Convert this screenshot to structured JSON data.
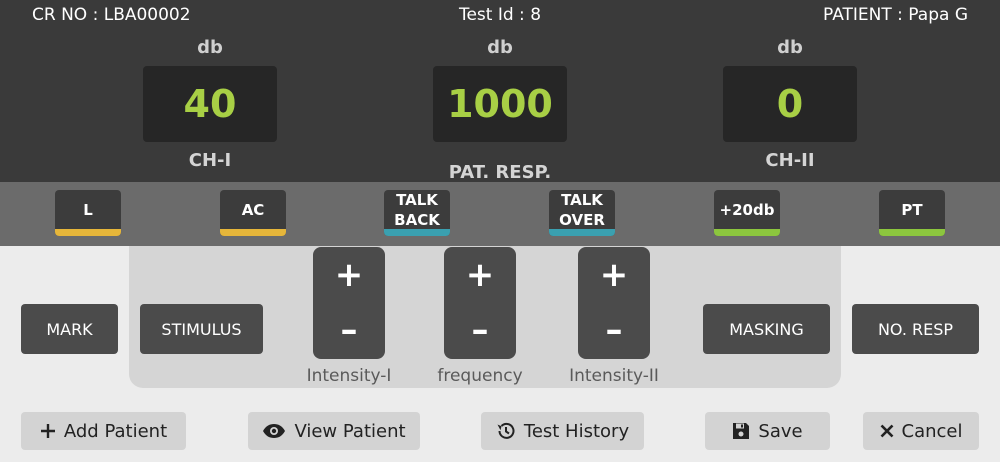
{
  "header": {
    "cr_no": "CR NO : LBA00002",
    "test_id": "Test Id : 8",
    "patient": "PATIENT : Papa G"
  },
  "channels": [
    {
      "unit": "db",
      "value": "40",
      "label": "CH-I"
    },
    {
      "unit": "db",
      "value": "1000",
      "label": "PAT. RESP."
    },
    {
      "unit": "db",
      "value": "0",
      "label": "CH-II"
    }
  ],
  "colors": {
    "value_green": "#a8cf45",
    "bar_yellow": "#e6b63a",
    "bar_teal": "#3aa0b0",
    "bar_green": "#8cc63e"
  },
  "modes": [
    {
      "label": "L",
      "bar": "yellow"
    },
    {
      "label": "AC",
      "bar": "yellow"
    },
    {
      "label_lines": [
        "TALK",
        "BACK"
      ],
      "bar": "teal"
    },
    {
      "label_lines": [
        "TALK",
        "OVER"
      ],
      "bar": "teal"
    },
    {
      "label": "+20db",
      "bar": "green"
    },
    {
      "label": "PT",
      "bar": "green"
    }
  ],
  "controls": {
    "mark": "MARK",
    "stimulus": "STIMULUS",
    "masking": "MASKING",
    "no_resp": "NO. RESP",
    "plus_symbol": "+",
    "minus_symbol": "–",
    "steppers": [
      {
        "label": "Intensity-I"
      },
      {
        "label": "frequency"
      },
      {
        "label": "Intensity-II"
      }
    ]
  },
  "actions": {
    "add_patient": {
      "label": "Add Patient",
      "icon": "plus-icon"
    },
    "view_patient": {
      "label": "View Patient",
      "icon": "eye-icon"
    },
    "test_history": {
      "label": "Test History",
      "icon": "history-icon"
    },
    "save": {
      "label": "Save",
      "icon": "floppy-disk-icon"
    },
    "cancel": {
      "label": "Cancel",
      "icon": "close-icon"
    }
  }
}
